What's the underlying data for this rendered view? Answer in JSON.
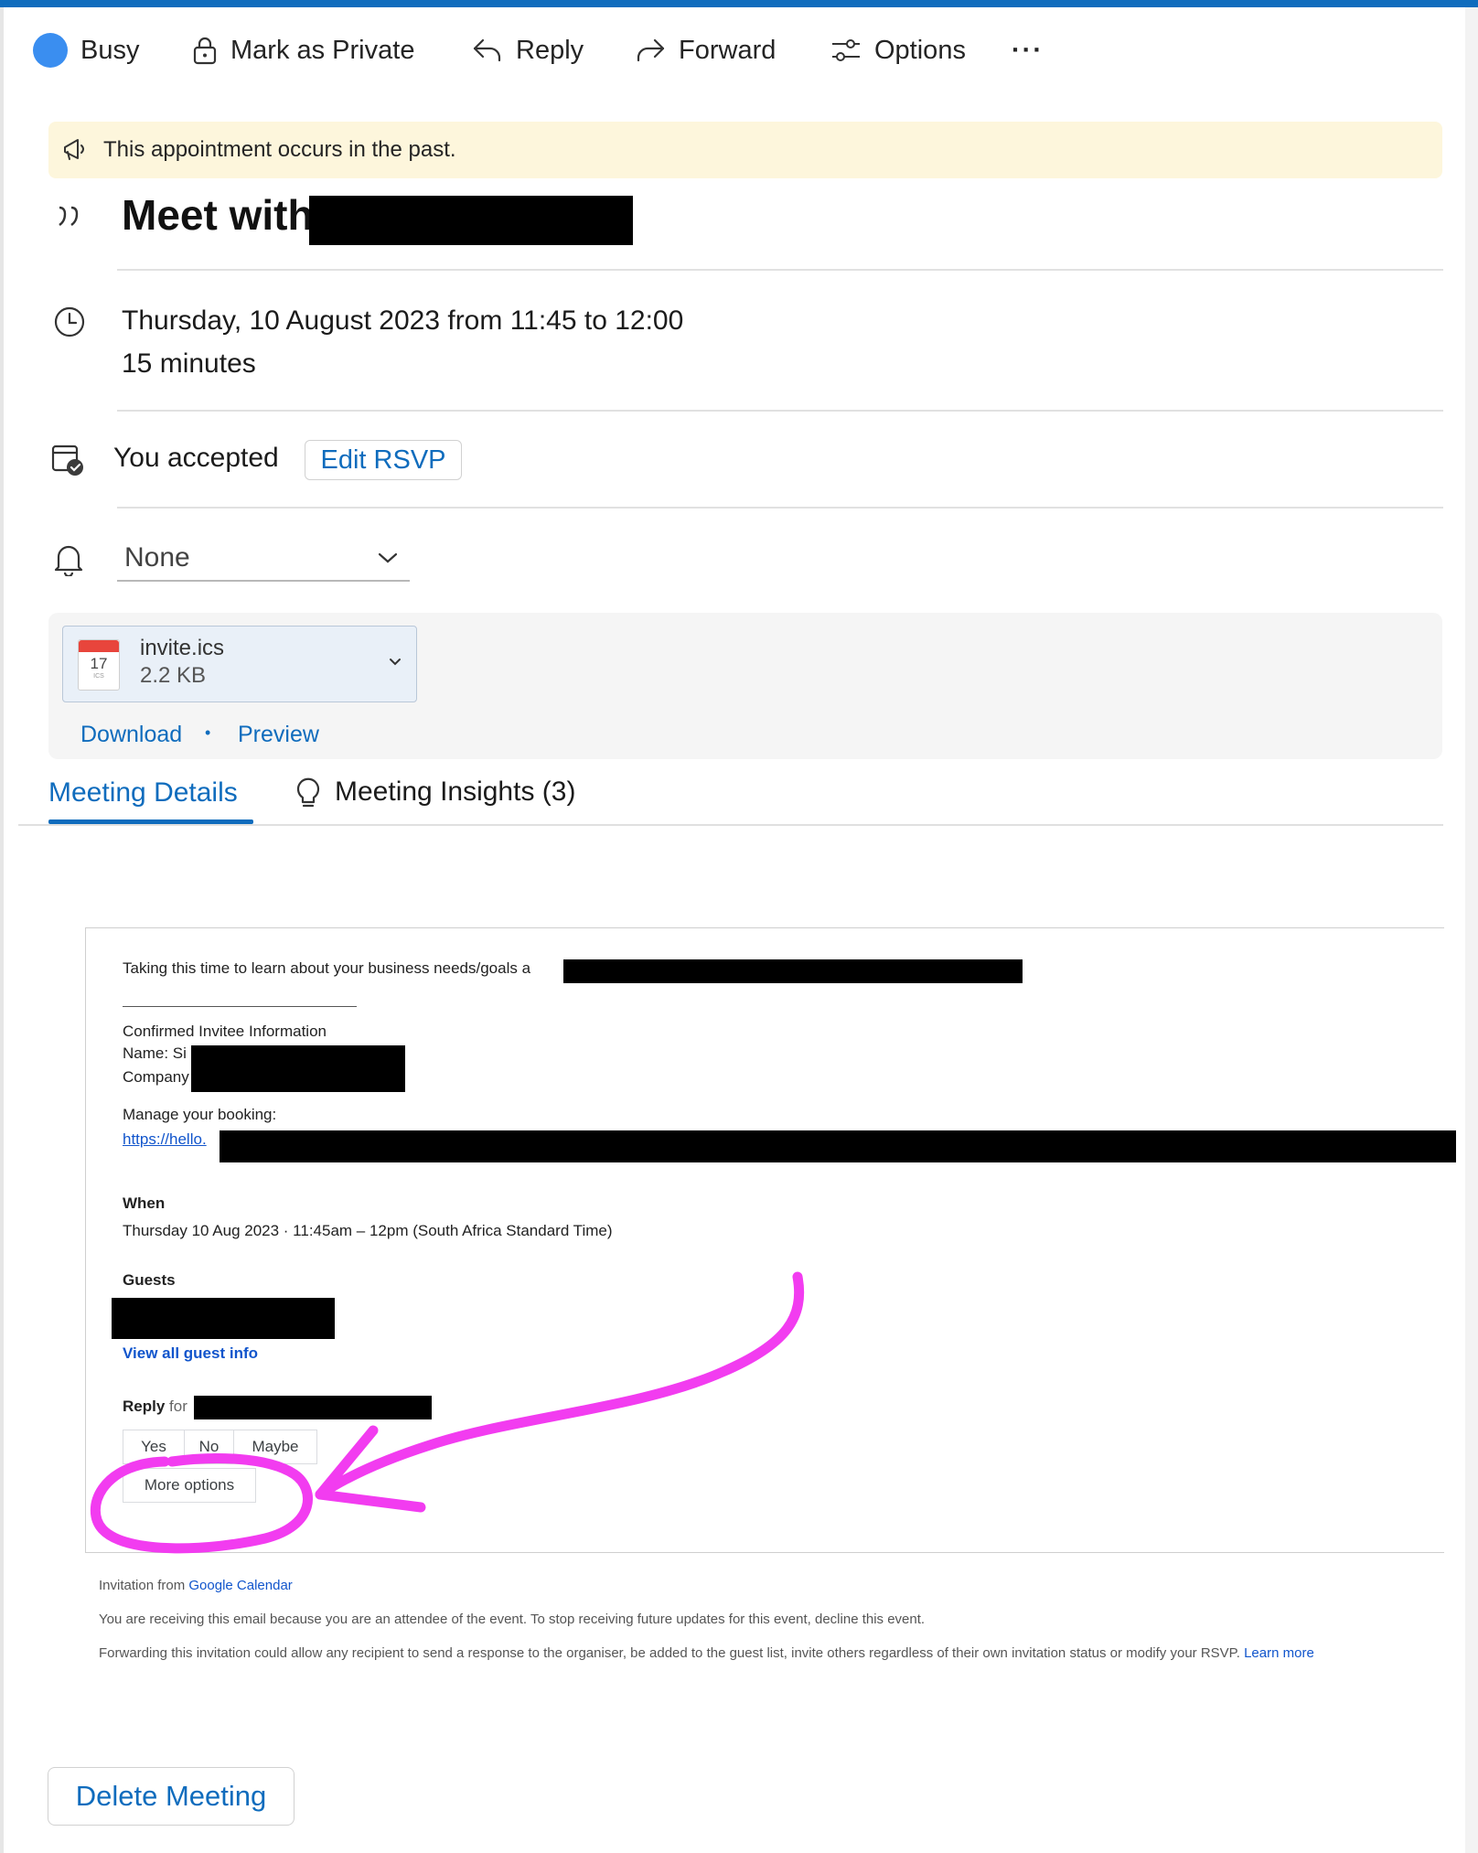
{
  "toolbar": {
    "busy_label": "Busy",
    "mark_private_label": "Mark as Private",
    "reply_label": "Reply",
    "forward_label": "Forward",
    "options_label": "Options",
    "more_label": "···"
  },
  "banner": {
    "text": "This appointment occurs in the past."
  },
  "event": {
    "title": "Meet with",
    "datetime": "Thursday, 10 August 2023 from 11:45 to 12:00",
    "duration": "15 minutes",
    "rsvp_status": "You accepted",
    "edit_rsvp_label": "Edit RSVP",
    "reminder_value": "None"
  },
  "attachment": {
    "filename": "invite.ics",
    "size": "2.2 KB",
    "icon_day": "17",
    "icon_ext": "ICS",
    "download_label": "Download",
    "separator": "•",
    "preview_label": "Preview"
  },
  "tabs": {
    "details_label": "Meeting Details",
    "insights_label": "Meeting Insights (3)"
  },
  "email": {
    "intro": "Taking this time to learn about your business needs/goals a",
    "divider_line": "________________________________",
    "confirmed_heading": "Confirmed Invitee Information",
    "name_label": "Name: Si",
    "company_label": "Company",
    "manage_label": "Manage your booking:",
    "manage_link": "https://hello.",
    "when_label": "When",
    "when_value": "Thursday 10 Aug 2023 · 11:45am – 12pm (South Africa Standard Time)",
    "guests_label": "Guests",
    "view_guest_link": "View all guest info",
    "reply_label": "Reply",
    "reply_for": "for",
    "btn_yes": "Yes",
    "btn_no": "No",
    "btn_maybe": "Maybe",
    "btn_more": "More options"
  },
  "footer": {
    "invitation_from": "Invitation from",
    "google_calendar_link": "Google Calendar",
    "receiving_text": "You are receiving this email because you are an attendee of the event. To stop receiving future updates for this event, decline this event.",
    "forwarding_text": "Forwarding this invitation could allow any recipient to send a response to the organiser, be added to the guest list, invite others regardless of their own invitation status or modify your RSVP.",
    "learn_more_link": "Learn more"
  },
  "actions": {
    "delete_label": "Delete Meeting"
  },
  "colors": {
    "accent": "#0f6cbd",
    "busy": "#3a8ef0",
    "banner_bg": "#fdf6dc",
    "annotation": "#f23cf0"
  }
}
